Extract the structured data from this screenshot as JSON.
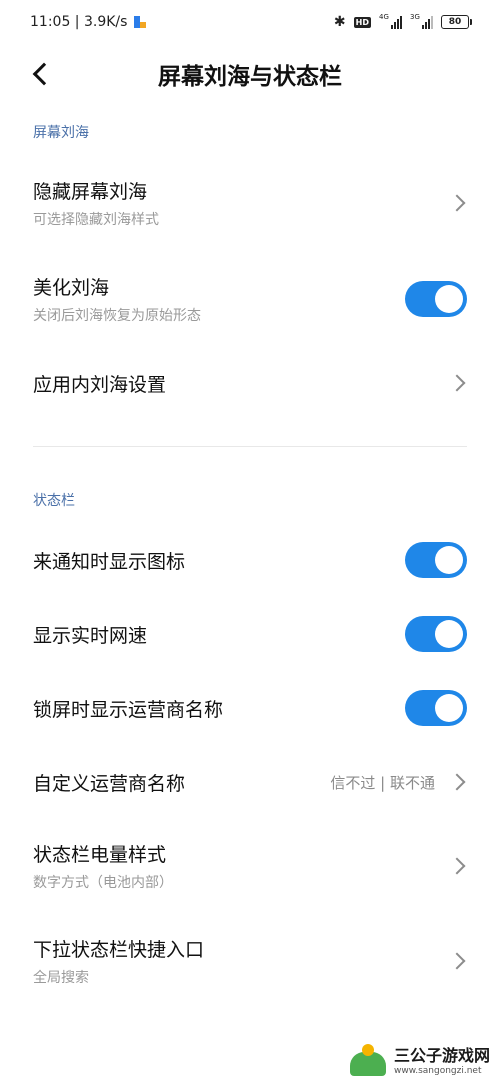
{
  "status_bar": {
    "time_speed": "11:05 | 3.9K/s",
    "hd": "HD",
    "sim1": "4G",
    "sim2": "3G",
    "battery": "80"
  },
  "nav": {
    "title": "屏幕刘海与状态栏"
  },
  "sections": {
    "notch": {
      "header": "屏幕刘海",
      "items": [
        {
          "title": "隐藏屏幕刘海",
          "subtitle": "可选择隐藏刘海样式",
          "control": "chevron"
        },
        {
          "title": "美化刘海",
          "subtitle": "关闭后刘海恢复为原始形态",
          "control": "toggle",
          "on": true
        },
        {
          "title": "应用内刘海设置",
          "control": "chevron"
        }
      ]
    },
    "statusbar": {
      "header": "状态栏",
      "items": [
        {
          "title": "来通知时显示图标",
          "control": "toggle",
          "on": true
        },
        {
          "title": "显示实时网速",
          "control": "toggle",
          "on": true
        },
        {
          "title": "锁屏时显示运营商名称",
          "control": "toggle",
          "on": true
        },
        {
          "title": "自定义运营商名称",
          "value": "信不过 | 联不通",
          "control": "chevron"
        },
        {
          "title": "状态栏电量样式",
          "subtitle": "数字方式（电池内部）",
          "control": "chevron"
        },
        {
          "title": "下拉状态栏快捷入口",
          "subtitle": "全局搜索",
          "control": "chevron"
        }
      ]
    }
  },
  "colors": {
    "accent": "#1f87e8",
    "section_header": "#4a70a8"
  },
  "watermark": {
    "name": "三公子游戏网",
    "url": "www.sangongzi.net"
  }
}
